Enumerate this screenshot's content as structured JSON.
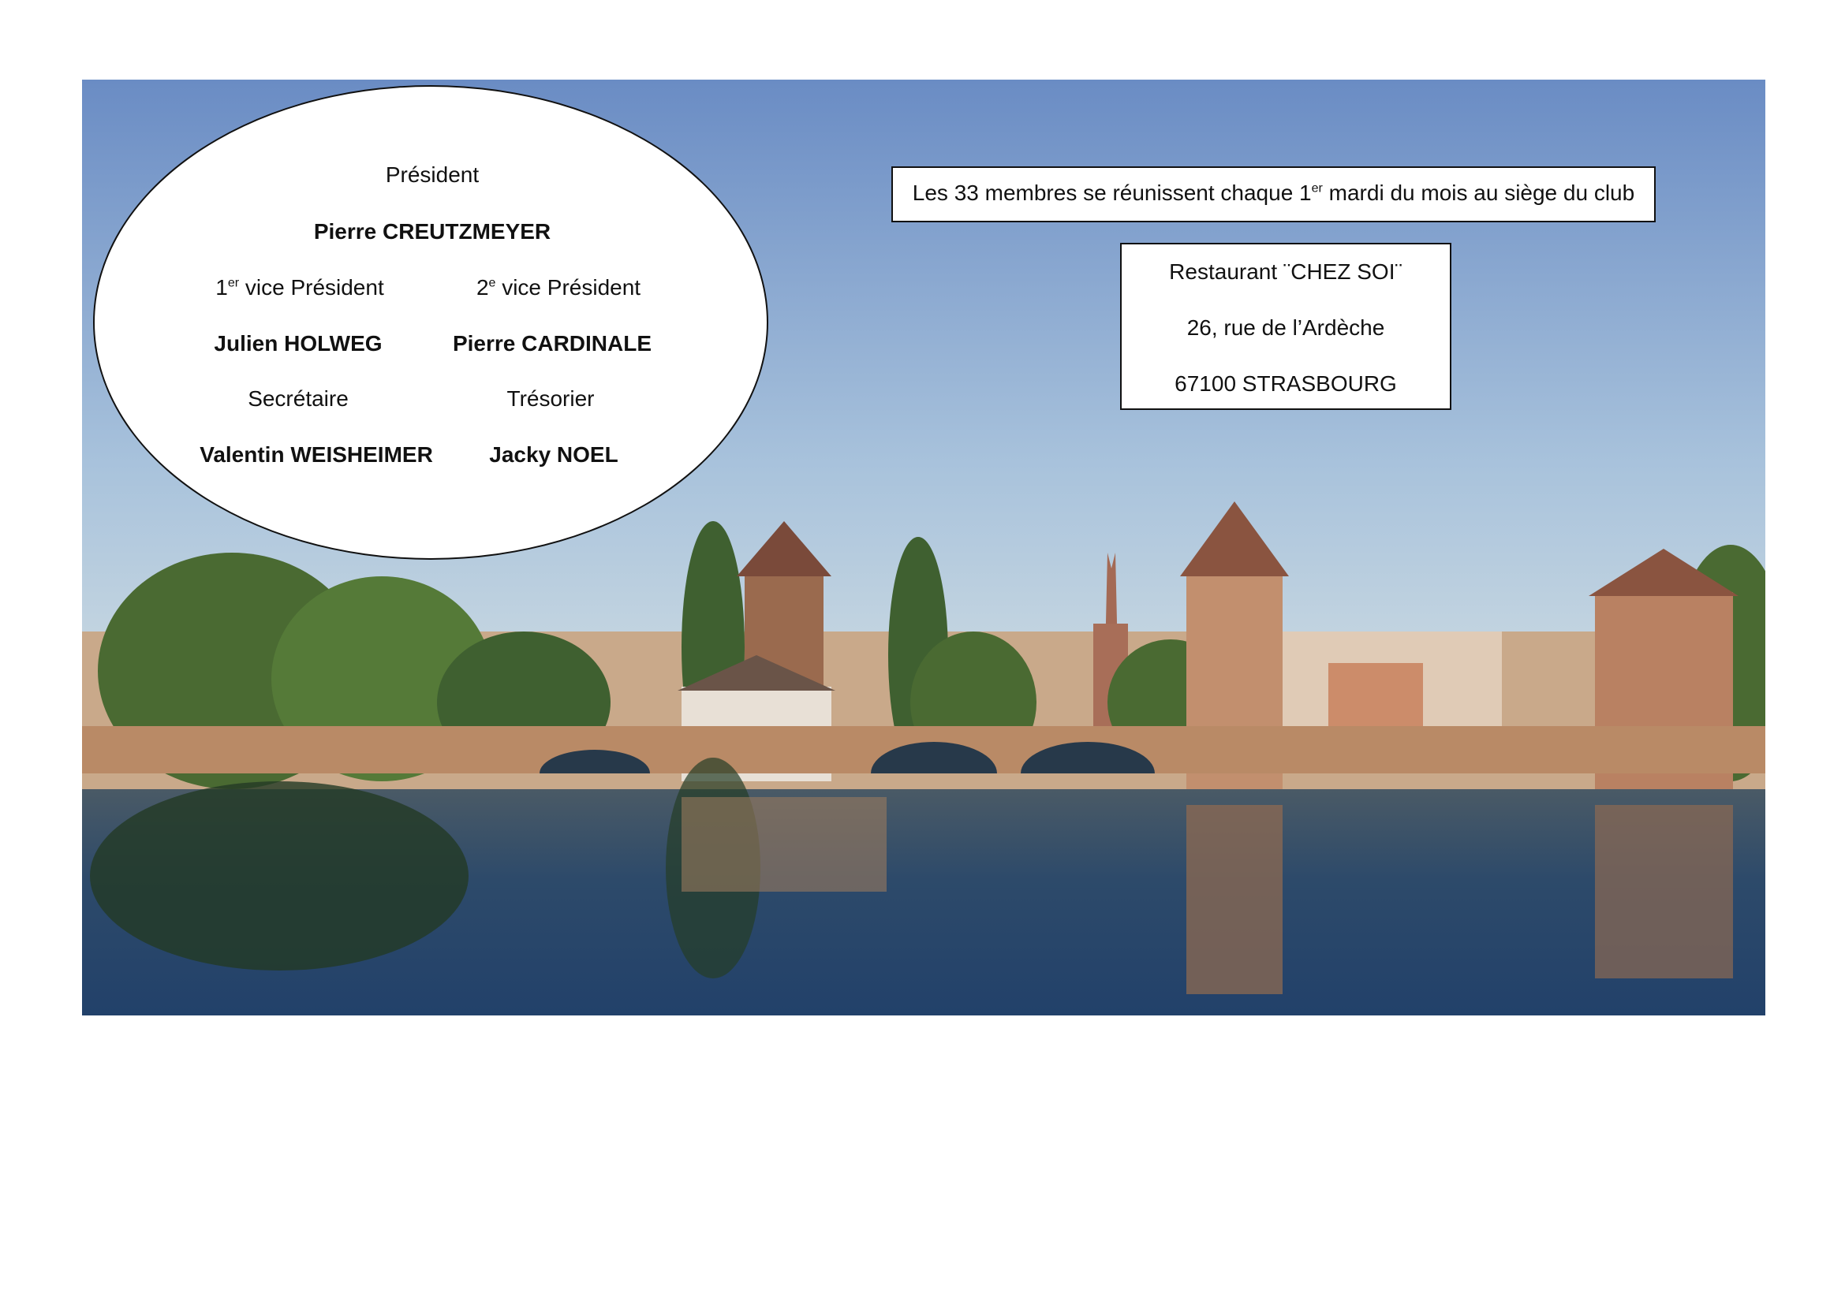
{
  "photo": {
    "subject": "strasbourg-ponts-couverts-photo"
  },
  "officers": {
    "president_title": "Président",
    "president_name": "Pierre CREUTZMEYER",
    "vp1_title_num": "1",
    "vp1_title_sup": "er",
    "vp1_title_rest": " vice Président",
    "vp2_title_num": "2",
    "vp2_title_sup": "e",
    "vp2_title_rest": " vice Président",
    "vp1_name": "Julien HOLWEG",
    "vp2_name": "Pierre CARDINALE",
    "secretary_title": "Secrétaire",
    "treasurer_title": "Trésorier",
    "secretary_name": "Valentin WEISHEIMER",
    "treasurer_name": "Jacky NOEL"
  },
  "meeting": {
    "text_before": "Les 33 membres se réunissent chaque 1",
    "text_sup": "er",
    "text_after": " mardi du mois au siège du club"
  },
  "address": {
    "line1": "Restaurant ¨CHEZ SOI¨",
    "line2": "26, rue de l’Ardèche",
    "line3": "67100 STRASBOURG"
  },
  "colors": {
    "sky_top": "#6a8cc4",
    "sky_bottom": "#cfe0ea",
    "water": "#2c4a6e",
    "stone": "#b98a66"
  }
}
